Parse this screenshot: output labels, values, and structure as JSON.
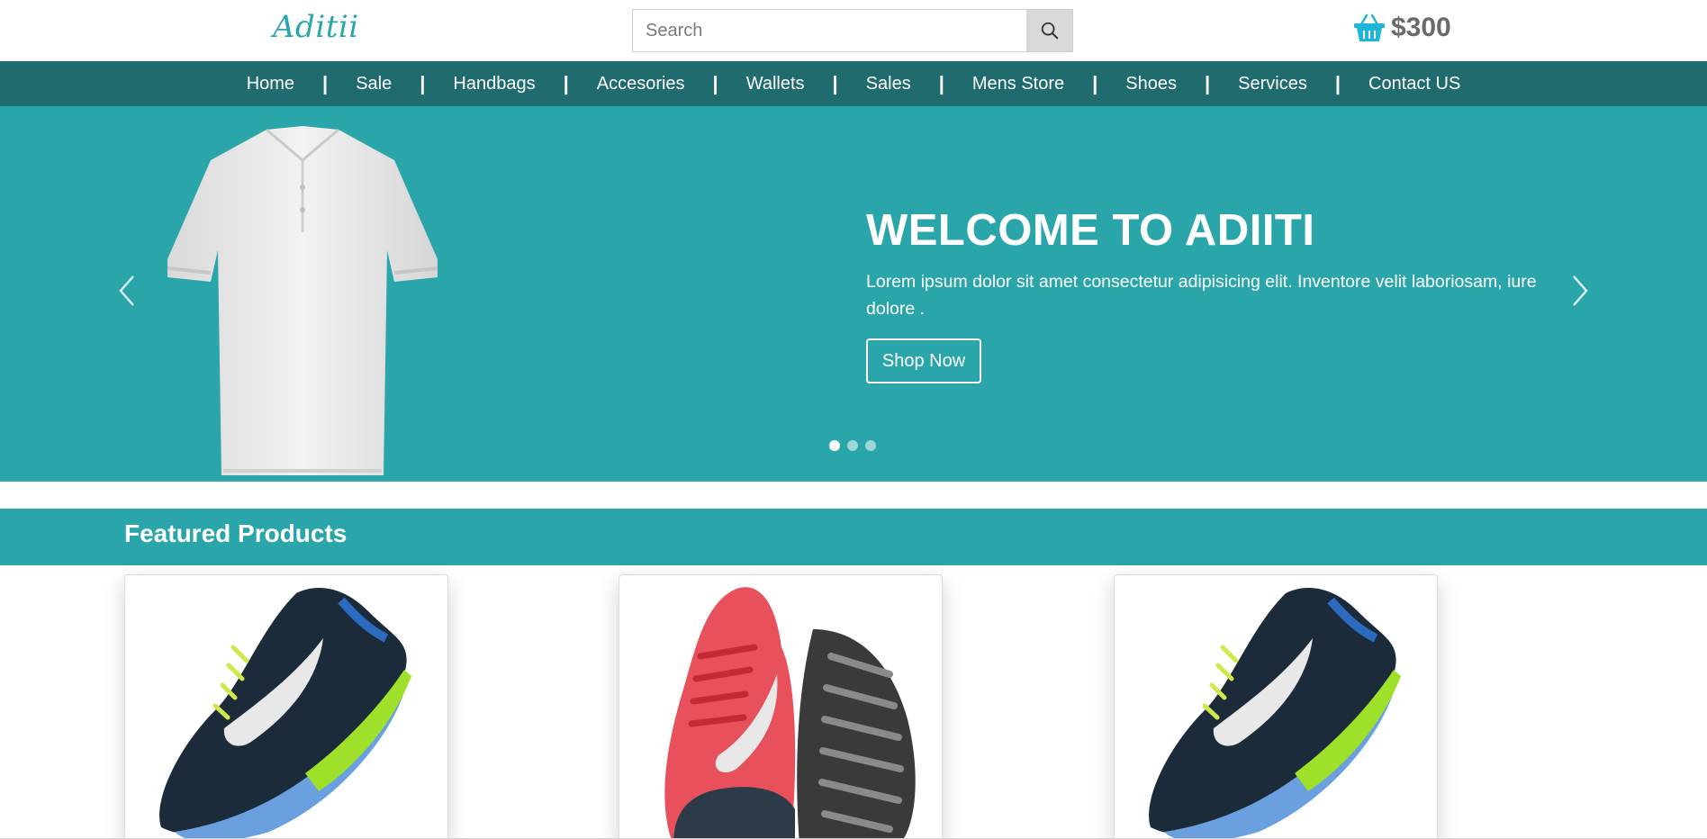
{
  "header": {
    "logo": "Aditii",
    "search_placeholder": "Search",
    "cart_total": "$300"
  },
  "nav": {
    "items": [
      "Home",
      "Sale",
      "Handbags",
      "Accesories",
      "Wallets",
      "Sales",
      "Mens Store",
      "Shoes",
      "Services",
      "Contact US"
    ],
    "separator": "|"
  },
  "hero": {
    "title": "WELCOME TO ADIITI",
    "text": "Lorem ipsum dolor sit amet consectetur adipisicing elit. Inventore velit laboriosam, iure dolore .",
    "button": "Shop Now",
    "slide_count": 3,
    "active_slide": 1
  },
  "featured": {
    "title": "Featured Products",
    "products": [
      {
        "image": "blue-running-shoe"
      },
      {
        "image": "red-running-shoe"
      },
      {
        "image": "blue-running-shoe"
      }
    ]
  },
  "colors": {
    "brand_teal": "#2aa6aa",
    "nav_dark_teal": "#1f6b6d",
    "cart_icon": "#1fb6d6"
  }
}
